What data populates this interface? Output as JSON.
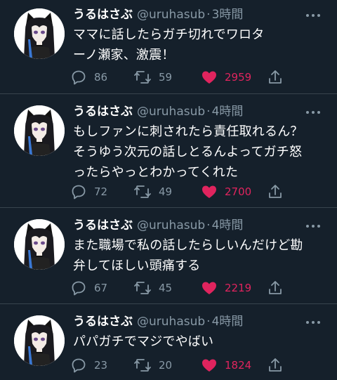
{
  "colors": {
    "background": "#15202b",
    "secondary_text": "#8899a6",
    "like_active": "#e0245e",
    "divider": "#38444d"
  },
  "tweets": [
    {
      "name": "うるはさぶ",
      "handle": "@uruhasub",
      "separator": "·",
      "time": "3時間",
      "text": "ママに話したらガチ切れでワロタ\nーノ瀬家、激震！",
      "replies": "86",
      "retweets": "59",
      "likes": "2959",
      "liked": true
    },
    {
      "name": "うるはさぶ",
      "handle": "@uruhasub",
      "separator": "·",
      "time": "4時間",
      "text": "もしファンに刺されたら責任取れるん？\nそうゆう次元の話しとるんよってガチ怒\nったらやっとわかってくれた",
      "replies": "72",
      "retweets": "49",
      "likes": "2700",
      "liked": true
    },
    {
      "name": "うるはさぶ",
      "handle": "@uruhasub",
      "separator": "·",
      "time": "4時間",
      "text": "また職場で私の話したらしいんだけど勘\n弁してほしい頭痛する",
      "replies": "67",
      "retweets": "45",
      "likes": "2219",
      "liked": true
    },
    {
      "name": "うるはさぶ",
      "handle": "@uruhasub",
      "separator": "·",
      "time": "4時間",
      "text": "パパガチでマジでやばい",
      "replies": "23",
      "retweets": "20",
      "likes": "1824",
      "liked": true
    }
  ]
}
